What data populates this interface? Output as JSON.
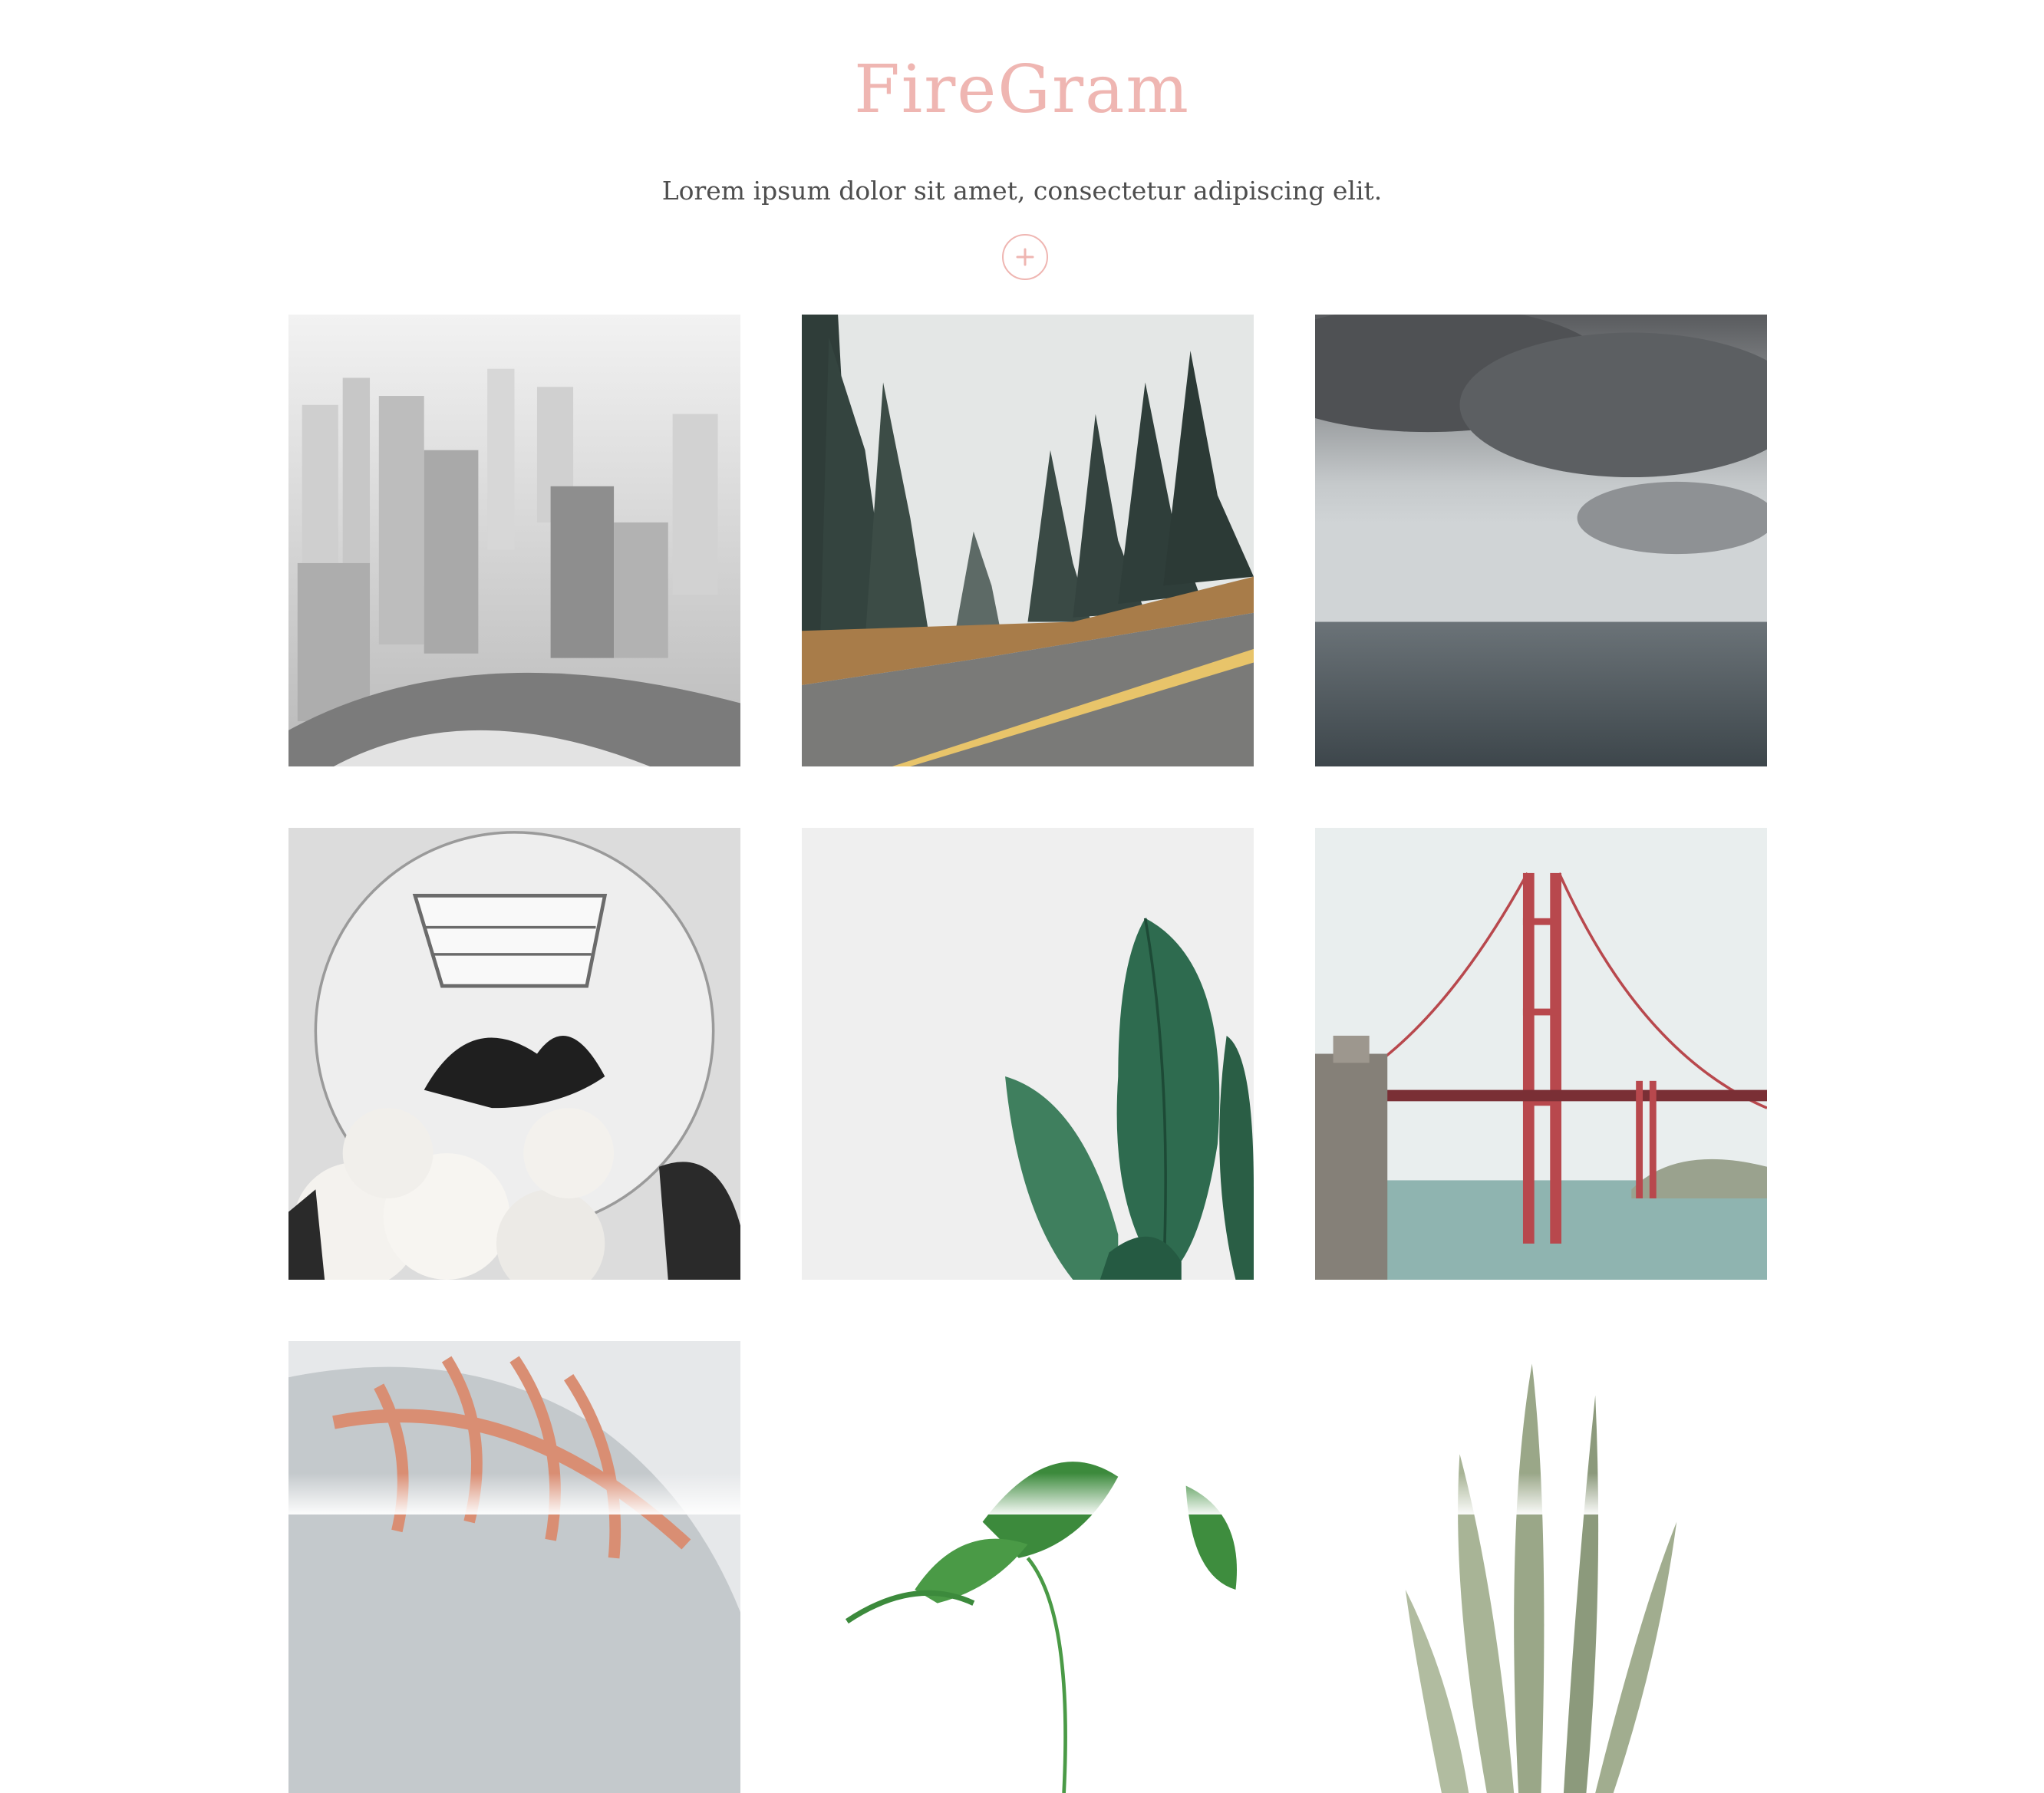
{
  "header": {
    "title": "FireGram",
    "subtitle": "Lorem ipsum dolor sit amet, consectetur adipiscing elit.",
    "upload_icon": "plus-icon"
  },
  "colors": {
    "accent": "#EFB6B2",
    "text": "#4e4e4e",
    "background": "#ffffff"
  },
  "gallery": {
    "images": [
      {
        "subject": "foggy-city-skyline"
      },
      {
        "subject": "forest-road"
      },
      {
        "subject": "stormy-sea"
      },
      {
        "subject": "mirror-with-flowers"
      },
      {
        "subject": "plant-leaves"
      },
      {
        "subject": "golden-gate-bridge"
      },
      {
        "subject": "sneaker-pink-laces"
      },
      {
        "subject": "monstera-plant"
      },
      {
        "subject": "snake-plant"
      }
    ]
  }
}
